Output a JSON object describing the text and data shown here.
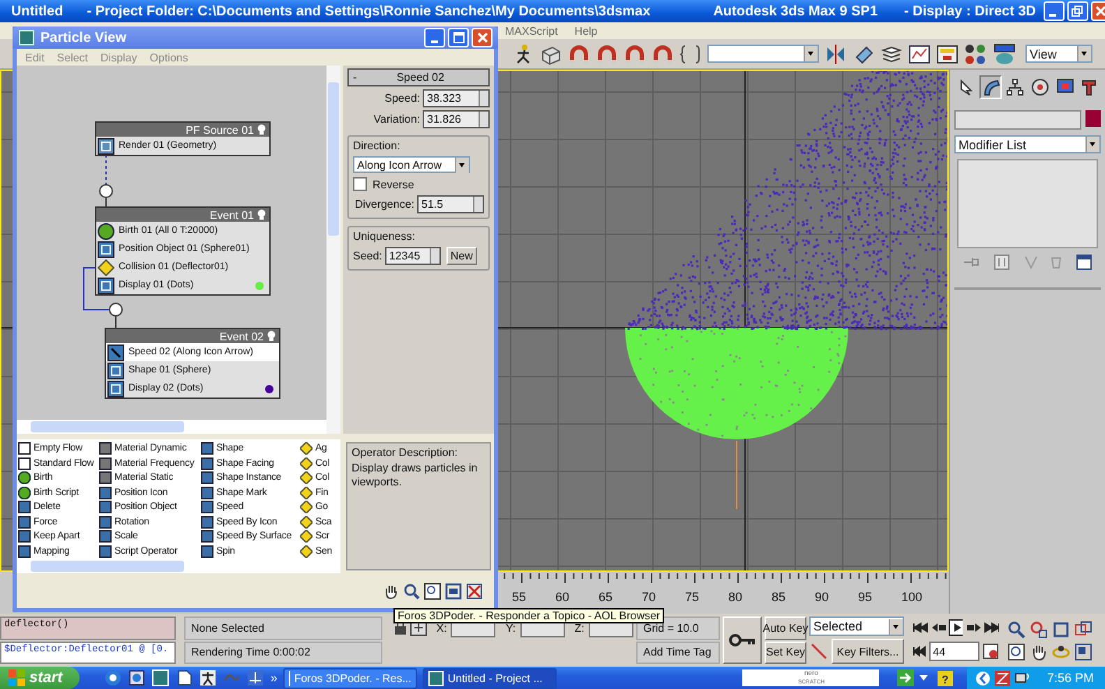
{
  "main_window": {
    "title": "Untitled",
    "project": "- Project Folder: C:\\Documents and Settings\\Ronnie Sanchez\\My Documents\\3dsmax",
    "app": "Autodesk 3ds Max 9 SP1",
    "display": "- Display : Direct 3D"
  },
  "menu_bar": [
    "MAXScript",
    "Help"
  ],
  "toolbar": {
    "view_dropdown": "View"
  },
  "command_panel": {
    "tabs": [
      {
        "kind": "create",
        "selected": false
      },
      {
        "kind": "modify",
        "selected": true
      },
      {
        "kind": "hierarchy",
        "selected": false
      },
      {
        "kind": "motion",
        "selected": false
      },
      {
        "kind": "display",
        "selected": false
      },
      {
        "kind": "utilities",
        "selected": false
      }
    ],
    "modifier_list": "Modifier List"
  },
  "particle_view": {
    "title": "Particle View",
    "menu": [
      "Edit",
      "Select",
      "Display",
      "Options"
    ],
    "nodes": [
      {
        "title": "PF Source 01",
        "items": [
          {
            "label": "Render 01 (Geometry)",
            "kind": "render",
            "selected": false
          }
        ]
      },
      {
        "title": "Event 01",
        "items": [
          {
            "label": "Birth 01 (All 0 T:20000)",
            "kind": "birth",
            "selected": false
          },
          {
            "label": "Position Object 01 (Sphere01)",
            "kind": "position",
            "selected": false
          },
          {
            "label": "Collision 01 (Deflector01)",
            "kind": "test",
            "selected": false
          },
          {
            "label": "Display 01 (Dots)",
            "kind": "display",
            "selected": false,
            "color": "#66ee44"
          }
        ]
      },
      {
        "title": "Event 02",
        "items": [
          {
            "label": "Speed 02 (Along Icon Arrow)",
            "kind": "speed",
            "selected": true
          },
          {
            "label": "Shape 01 (Sphere)",
            "kind": "shape",
            "selected": false
          },
          {
            "label": "Display 02 (Dots)",
            "kind": "display",
            "selected": false,
            "color": "#440099"
          }
        ]
      }
    ],
    "parameters": {
      "rollout": "Speed 02",
      "collapse": "-",
      "fields": [
        {
          "label": "Speed:",
          "value": "38.323"
        },
        {
          "label": "Variation:",
          "value": "31.826"
        }
      ],
      "direction": {
        "title": "Direction:",
        "dropdown": "Along Icon Arrow",
        "reverse": {
          "label": "Reverse",
          "checked": false
        },
        "divergence_label": "Divergence:",
        "divergence": "51.5"
      },
      "uniqueness": {
        "title": "Uniqueness:",
        "seed_label": "Seed:",
        "seed": "12345",
        "button": "New"
      }
    },
    "depot": [
      [
        {
          "label": "Empty Flow",
          "kind": "flow"
        },
        {
          "label": "Standard Flow",
          "kind": "flow"
        },
        {
          "label": "Birth",
          "kind": "birth"
        },
        {
          "label": "Birth Script",
          "kind": "birth"
        },
        {
          "label": "Delete",
          "kind": "operator"
        },
        {
          "label": "Force",
          "kind": "operator"
        },
        {
          "label": "Keep Apart",
          "kind": "operator"
        },
        {
          "label": "Mapping",
          "kind": "operator"
        }
      ],
      [
        {
          "label": "Material Dynamic",
          "kind": "material"
        },
        {
          "label": "Material Frequency",
          "kind": "material"
        },
        {
          "label": "Material Static",
          "kind": "material"
        },
        {
          "label": "Position Icon",
          "kind": "operator"
        },
        {
          "label": "Position Object",
          "kind": "operator"
        },
        {
          "label": "Rotation",
          "kind": "operator"
        },
        {
          "label": "Scale",
          "kind": "operator"
        },
        {
          "label": "Script Operator",
          "kind": "operator"
        }
      ],
      [
        {
          "label": "Shape",
          "kind": "operator"
        },
        {
          "label": "Shape Facing",
          "kind": "operator"
        },
        {
          "label": "Shape Instance",
          "kind": "operator"
        },
        {
          "label": "Shape Mark",
          "kind": "operator"
        },
        {
          "label": "Speed",
          "kind": "operator"
        },
        {
          "label": "Speed By Icon",
          "kind": "operator"
        },
        {
          "label": "Speed By Surface",
          "kind": "operator"
        },
        {
          "label": "Spin",
          "kind": "operator"
        }
      ],
      [
        {
          "label": "Ag",
          "kind": "test"
        },
        {
          "label": "Col",
          "kind": "test"
        },
        {
          "label": "Col",
          "kind": "test"
        },
        {
          "label": "Fin",
          "kind": "test"
        },
        {
          "label": "Go",
          "kind": "test"
        },
        {
          "label": "Sca",
          "kind": "test"
        },
        {
          "label": "Scr",
          "kind": "test"
        },
        {
          "label": "Sen",
          "kind": "test"
        }
      ]
    ],
    "description": {
      "title": "Operator Description:",
      "text": "Display draws particles in viewports."
    }
  },
  "trackbar": {
    "ticks": [
      "55",
      "60",
      "65",
      "70",
      "75",
      "80",
      "85",
      "90",
      "95",
      "100"
    ]
  },
  "status": {
    "listener": [
      "deflector()",
      "$Deflector:Deflector01 @ [0."
    ],
    "selection": "None Selected",
    "prompt": "Rendering Time  0:00:02",
    "coords": [
      "X:",
      "Y:",
      "Z:"
    ],
    "grid": "Grid = 10.0",
    "time_tag": "Add Time Tag",
    "auto_key": "Auto Key",
    "set_key": "Set Key",
    "key_mode": "Selected",
    "key_filters": "Key Filters...",
    "frame": "44"
  },
  "taskbar": {
    "start": "start",
    "chevron": "»",
    "tasks": [
      {
        "label": "Foros 3DPoder. - Res...",
        "selected": false
      },
      {
        "label": "Untitled     - Project ...",
        "selected": true
      }
    ],
    "help_glyph": "?",
    "nero": "nero",
    "scratch": "SCRATCH",
    "clock": "7:56 PM"
  },
  "tooltip": "Foros 3DPoder. - Responder a Topico - AOL Browser"
}
